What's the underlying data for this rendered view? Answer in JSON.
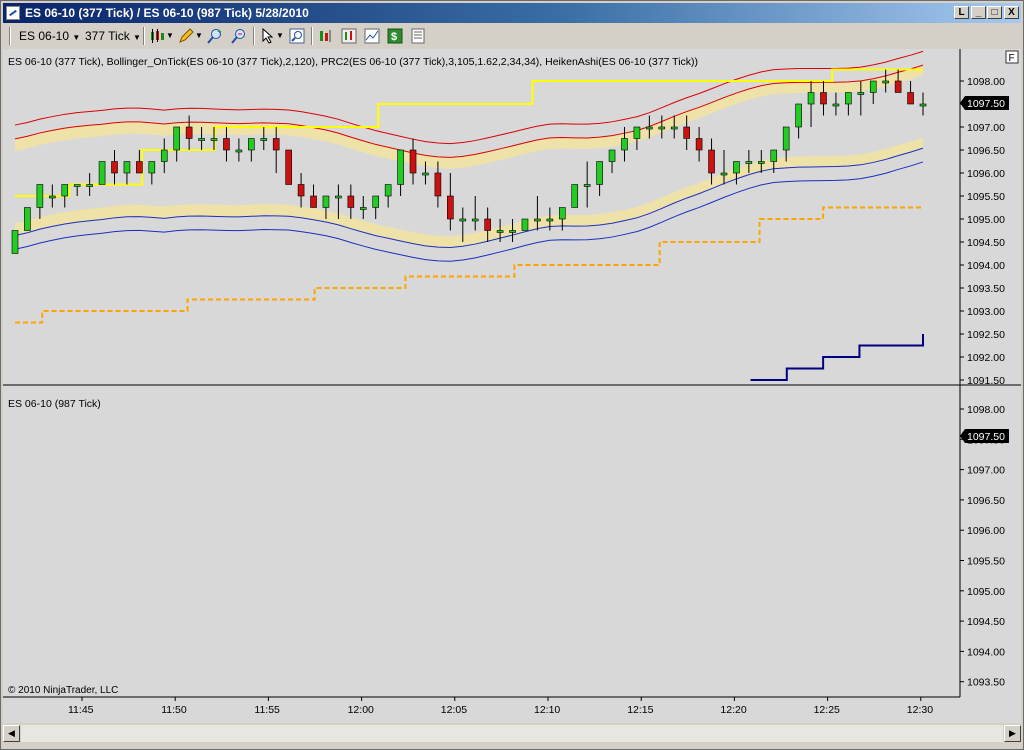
{
  "window": {
    "title": "ES 06-10 (377 Tick) / ES 06-10 (987 Tick)  5/28/2010",
    "buttons": {
      "restore_small": "L",
      "minimize": "_",
      "maximize": "□",
      "close": "X"
    }
  },
  "toolbar": {
    "instrument": "ES 06-10",
    "interval": "377 Tick",
    "icons": [
      "candlestick-style-icon",
      "pencil-draw-icon",
      "zoom-in-icon",
      "zoom-out-icon",
      "cursor-pointer-icon",
      "magnify-icon",
      "bar-spacing-icon",
      "chart-data-icon",
      "chart-line-icon",
      "dollar-icon",
      "properties-icon"
    ]
  },
  "top_panel": {
    "label": "ES 06-10 (377 Tick), Bollinger_OnTick(ES 06-10 (377 Tick),2,120), PRC2(ES 06-10 (377 Tick),3,105,1.62,2,34,34), HeikenAshi(ES 06-10 (377 Tick))",
    "price_marker": "1097.50",
    "y_ticks": [
      "1098.00",
      "1097.50",
      "1097.00",
      "1096.50",
      "1096.00",
      "1095.50",
      "1095.00",
      "1094.50",
      "1094.00",
      "1093.50",
      "1093.00",
      "1092.50",
      "1092.00",
      "1091.50"
    ],
    "f_badge": "F"
  },
  "bottom_panel": {
    "label": "ES 06-10 (987 Tick)",
    "price_marker": "1097.50",
    "y_ticks": [
      "1098.00",
      "1097.50",
      "1097.00",
      "1096.50",
      "1096.00",
      "1095.50",
      "1095.00",
      "1094.50",
      "1094.00",
      "1093.50"
    ],
    "copyright": "© 2010 NinjaTrader, LLC"
  },
  "x_axis": {
    "ticks": [
      "11:45",
      "11:50",
      "11:55",
      "12:00",
      "12:05",
      "12:10",
      "12:15",
      "12:20",
      "12:25",
      "12:30"
    ]
  },
  "colors": {
    "chart_bg": "#d8d8d8",
    "up_candle": "#22cc22",
    "down_candle": "#cc1111",
    "bollinger": "#ffff00",
    "prc_upper": "#dd0000",
    "prc_lower": "#1a2fbf",
    "prc_fill": "#eee2a8",
    "support_line": "#ffa500",
    "navy_line": "#000080"
  },
  "chart_data": {
    "type": "line",
    "y_axis_price_range": [
      1091.25,
      1098.25
    ],
    "bollinger_upper_steps": [
      [
        0,
        1095.5
      ],
      [
        6,
        1095.75
      ],
      [
        14,
        1096.5
      ],
      [
        22,
        1097.0
      ],
      [
        40,
        1097.5
      ],
      [
        57,
        1098.0
      ],
      [
        90,
        1098.25
      ],
      [
        100,
        1098.25
      ]
    ],
    "support_steps": [
      [
        0,
        1092.75
      ],
      [
        3,
        1093.0
      ],
      [
        19,
        1093.25
      ],
      [
        33,
        1093.5
      ],
      [
        43,
        1093.75
      ],
      [
        55,
        1094.0
      ],
      [
        71,
        1094.5
      ],
      [
        82,
        1095.0
      ],
      [
        89,
        1095.25
      ],
      [
        100,
        1095.25
      ]
    ],
    "navy_steps": [
      [
        81,
        1091.5
      ],
      [
        85,
        1091.75
      ],
      [
        89,
        1092.0
      ],
      [
        93,
        1092.25
      ],
      [
        100,
        1092.5
      ]
    ],
    "candles": [
      [
        1094.25,
        1094.75,
        1094.25,
        1094.75
      ],
      [
        1094.75,
        1095.25,
        1094.75,
        1095.25
      ],
      [
        1095.25,
        1095.75,
        1095.0,
        1095.75
      ],
      [
        1095.5,
        1095.75,
        1095.25,
        1095.5
      ],
      [
        1095.5,
        1095.75,
        1095.25,
        1095.75
      ],
      [
        1095.75,
        1095.75,
        1095.5,
        1095.75
      ],
      [
        1095.75,
        1096.0,
        1095.5,
        1095.75
      ],
      [
        1095.75,
        1096.25,
        1095.75,
        1096.25
      ],
      [
        1096.25,
        1096.5,
        1095.75,
        1096.0
      ],
      [
        1096.0,
        1096.25,
        1095.75,
        1096.25
      ],
      [
        1096.25,
        1096.5,
        1096.0,
        1096.0
      ],
      [
        1096.0,
        1096.25,
        1095.75,
        1096.25
      ],
      [
        1096.25,
        1096.75,
        1096.0,
        1096.5
      ],
      [
        1096.5,
        1096.75,
        1096.25,
        1097.0
      ],
      [
        1097.0,
        1097.25,
        1096.5,
        1096.75
      ],
      [
        1096.75,
        1097.0,
        1096.5,
        1096.75
      ],
      [
        1096.75,
        1097.0,
        1096.5,
        1096.75
      ],
      [
        1096.75,
        1097.0,
        1096.25,
        1096.5
      ],
      [
        1096.5,
        1096.75,
        1096.25,
        1096.5
      ],
      [
        1096.5,
        1096.75,
        1096.25,
        1096.75
      ],
      [
        1096.75,
        1097.0,
        1096.5,
        1096.75
      ],
      [
        1096.75,
        1097.0,
        1096.0,
        1096.5
      ],
      [
        1096.5,
        1096.5,
        1095.75,
        1095.75
      ],
      [
        1095.75,
        1096.0,
        1095.25,
        1095.5
      ],
      [
        1095.5,
        1095.75,
        1095.25,
        1095.25
      ],
      [
        1095.25,
        1095.5,
        1095.0,
        1095.5
      ],
      [
        1095.5,
        1095.75,
        1095.0,
        1095.5
      ],
      [
        1095.5,
        1095.75,
        1095.0,
        1095.25
      ],
      [
        1095.25,
        1095.5,
        1095.0,
        1095.25
      ],
      [
        1095.25,
        1095.5,
        1095.0,
        1095.5
      ],
      [
        1095.5,
        1095.75,
        1095.25,
        1095.75
      ],
      [
        1095.75,
        1096.5,
        1095.5,
        1096.5
      ],
      [
        1096.5,
        1096.75,
        1095.75,
        1096.0
      ],
      [
        1096.0,
        1096.25,
        1095.75,
        1096.0
      ],
      [
        1096.0,
        1096.25,
        1095.25,
        1095.5
      ],
      [
        1095.5,
        1096.0,
        1094.75,
        1095.0
      ],
      [
        1095.0,
        1095.25,
        1094.5,
        1095.0
      ],
      [
        1095.0,
        1095.5,
        1094.75,
        1095.0
      ],
      [
        1095.0,
        1095.25,
        1094.5,
        1094.75
      ],
      [
        1094.75,
        1095.0,
        1094.5,
        1094.75
      ],
      [
        1094.75,
        1095.0,
        1094.5,
        1094.75
      ],
      [
        1094.75,
        1095.0,
        1094.75,
        1095.0
      ],
      [
        1095.0,
        1095.5,
        1094.75,
        1095.0
      ],
      [
        1095.0,
        1095.25,
        1094.75,
        1095.0
      ],
      [
        1095.0,
        1095.25,
        1094.75,
        1095.25
      ],
      [
        1095.25,
        1095.75,
        1095.25,
        1095.75
      ],
      [
        1095.75,
        1096.25,
        1095.25,
        1095.75
      ],
      [
        1095.75,
        1096.25,
        1095.5,
        1096.25
      ],
      [
        1096.25,
        1096.5,
        1096.0,
        1096.5
      ],
      [
        1096.5,
        1097.0,
        1096.25,
        1096.75
      ],
      [
        1096.75,
        1097.0,
        1096.5,
        1097.0
      ],
      [
        1097.0,
        1097.25,
        1096.75,
        1097.0
      ],
      [
        1097.0,
        1097.25,
        1096.75,
        1097.0
      ],
      [
        1097.0,
        1097.25,
        1096.75,
        1097.0
      ],
      [
        1097.0,
        1097.25,
        1096.5,
        1096.75
      ],
      [
        1096.75,
        1097.0,
        1096.25,
        1096.5
      ],
      [
        1096.5,
        1096.75,
        1095.75,
        1096.0
      ],
      [
        1096.0,
        1096.5,
        1095.75,
        1096.0
      ],
      [
        1096.0,
        1096.25,
        1095.75,
        1096.25
      ],
      [
        1096.25,
        1096.5,
        1096.0,
        1096.25
      ],
      [
        1096.25,
        1096.5,
        1096.0,
        1096.25
      ],
      [
        1096.25,
        1096.5,
        1096.0,
        1096.5
      ],
      [
        1096.5,
        1097.0,
        1096.25,
        1097.0
      ],
      [
        1097.0,
        1097.5,
        1096.75,
        1097.5
      ],
      [
        1097.5,
        1098.0,
        1097.0,
        1097.75
      ],
      [
        1097.75,
        1098.0,
        1097.25,
        1097.5
      ],
      [
        1097.5,
        1097.75,
        1097.25,
        1097.5
      ],
      [
        1097.5,
        1097.75,
        1097.25,
        1097.75
      ],
      [
        1097.75,
        1098.0,
        1097.25,
        1097.75
      ],
      [
        1097.75,
        1098.0,
        1097.5,
        1098.0
      ],
      [
        1098.0,
        1098.25,
        1097.75,
        1098.0
      ],
      [
        1098.0,
        1098.25,
        1097.75,
        1097.75
      ],
      [
        1097.75,
        1098.0,
        1097.5,
        1097.5
      ],
      [
        1097.5,
        1097.75,
        1097.25,
        1097.5
      ]
    ]
  }
}
